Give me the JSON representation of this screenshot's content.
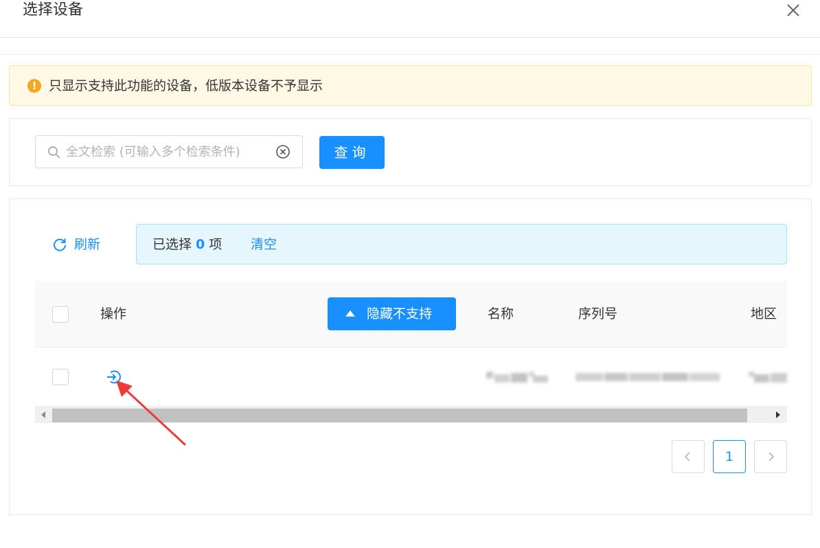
{
  "dialog": {
    "title": "选择设备",
    "close_icon": "close-icon"
  },
  "alert": {
    "text": "只显示支持此功能的设备，低版本设备不予显示",
    "icon": "warning-icon",
    "color": "#f5a623"
  },
  "search": {
    "placeholder": "全文检索 (可输入多个检索条件)",
    "value": "",
    "query_label": "查询"
  },
  "toolbar": {
    "refresh_label": "刷新",
    "selection_prefix": "已选择",
    "selection_count": "0",
    "selection_suffix": "项",
    "clear_label": "清空"
  },
  "table": {
    "headers": {
      "operation": "操作",
      "hide_unsupported": "隐藏不支持",
      "name": "名称",
      "serial": "序列号",
      "region": "地区"
    },
    "rows": [
      {
        "operation_icon": "enter-icon"
      }
    ]
  },
  "pagination": {
    "current_page": "1",
    "prev_icon": "chevron-left-icon",
    "next_icon": "chevron-right-icon"
  },
  "colors": {
    "primary": "#1890ff",
    "alert_bg": "#fef8e4",
    "info_bg": "#e6f6fd",
    "annotation": "#f03a3a"
  }
}
